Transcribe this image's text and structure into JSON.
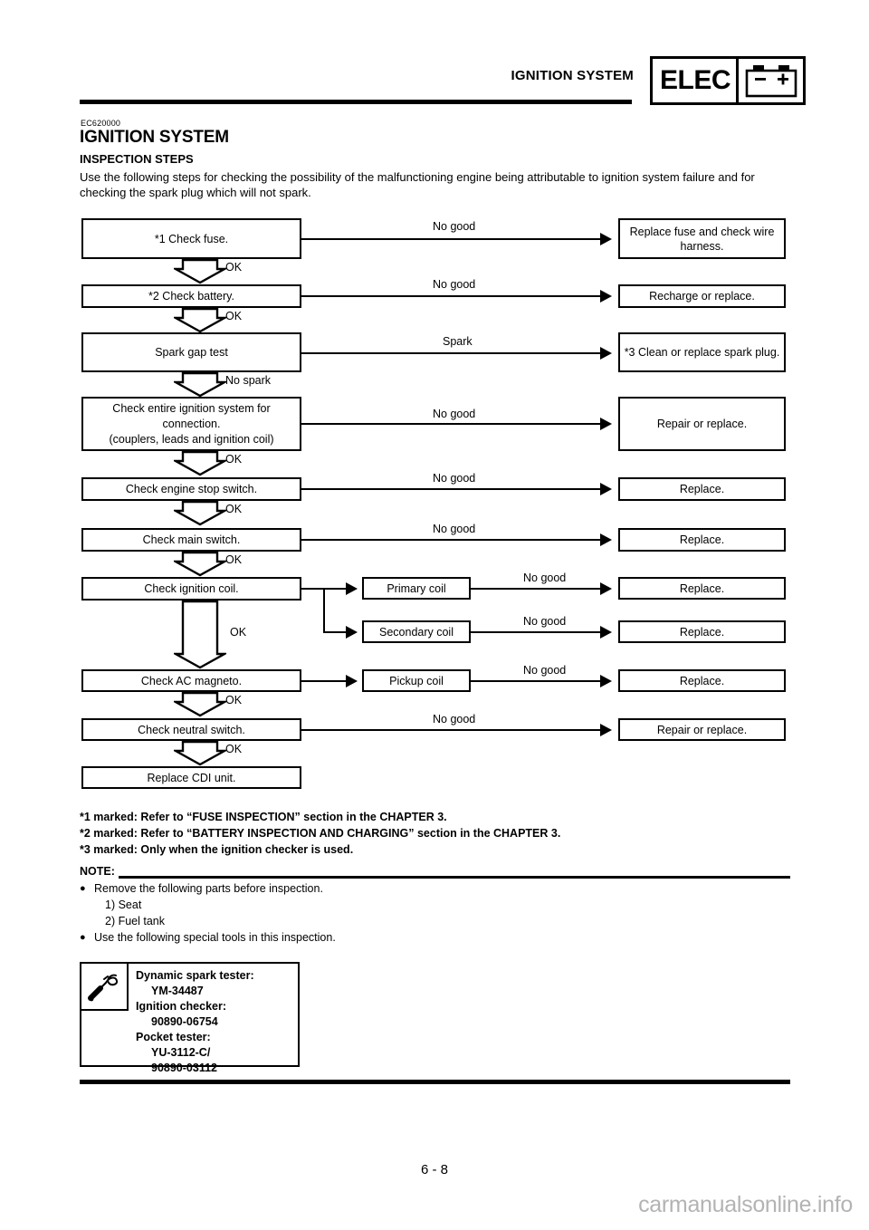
{
  "header": {
    "running_title": "IGNITION SYSTEM",
    "badge_text": "ELEC",
    "badge_icon": "battery-icon",
    "battery_minus": "–",
    "battery_plus": "+"
  },
  "document": {
    "ec_code": "EC620000",
    "title": "IGNITION SYSTEM",
    "subtitle": "INSPECTION STEPS",
    "intro": "Use the following steps for checking the possibility of the malfunctioning engine being attributable to ignition system failure and for checking the spark plug which will not spark."
  },
  "flowchart": {
    "type": "flowchart",
    "steps": [
      {
        "id": "check-fuse",
        "label": "*1 Check fuse.",
        "branch_label": "No good",
        "result": "Replace fuse and check wire harness.",
        "pass_label": "OK"
      },
      {
        "id": "check-battery",
        "label": "*2 Check battery.",
        "branch_label": "No good",
        "result": "Recharge or replace.",
        "pass_label": "OK"
      },
      {
        "id": "spark-gap-test",
        "label": "Spark gap test",
        "branch_label": "Spark",
        "result": "*3 Clean or replace spark plug.",
        "pass_label": "No spark"
      },
      {
        "id": "check-ignition-connections",
        "label": "Check entire ignition system for connection.\n(couplers, leads and ignition coil)",
        "branch_label": "No good",
        "result": "Repair or replace.",
        "pass_label": "OK"
      },
      {
        "id": "check-engine-stop-switch",
        "label": "Check engine stop switch.",
        "branch_label": "No good",
        "result": "Replace.",
        "pass_label": "OK"
      },
      {
        "id": "check-main-switch",
        "label": "Check main switch.",
        "branch_label": "No good",
        "result": "Replace.",
        "pass_label": "OK"
      },
      {
        "id": "check-ignition-coil",
        "label": "Check ignition coil.",
        "pass_label": "OK",
        "sub_steps": [
          {
            "id": "primary-coil",
            "label": "Primary coil",
            "branch_label": "No good",
            "result": "Replace."
          },
          {
            "id": "secondary-coil",
            "label": "Secondary coil",
            "branch_label": "No good",
            "result": "Replace."
          }
        ]
      },
      {
        "id": "check-ac-magneto",
        "label": "Check AC magneto.",
        "pass_label": "OK",
        "sub_steps": [
          {
            "id": "pickup-coil",
            "label": "Pickup coil",
            "branch_label": "No good",
            "result": "Replace."
          }
        ]
      },
      {
        "id": "check-neutral-switch",
        "label": "Check neutral switch.",
        "branch_label": "No good",
        "result": "Repair or replace.",
        "pass_label": "OK"
      },
      {
        "id": "replace-cdi-unit",
        "label": "Replace CDI unit."
      }
    ]
  },
  "footnotes": [
    "*1 marked: Refer to “FUSE INSPECTION” section in the CHAPTER 3.",
    "*2 marked: Refer to “BATTERY INSPECTION AND CHARGING” section in the CHAPTER 3.",
    "*3 marked: Only when the ignition checker is used."
  ],
  "note": {
    "heading": "NOTE:",
    "bullet1": "Remove the following parts before inspection.",
    "sub1": "1) Seat",
    "sub2": "2) Fuel tank",
    "bullet2": "Use the following special tools in this inspection."
  },
  "toolbox": {
    "icon": "spark-tester-icon",
    "lines": [
      {
        "text": "Dynamic spark tester:",
        "indent": false
      },
      {
        "text": "YM-34487",
        "indent": true
      },
      {
        "text": "Ignition checker:",
        "indent": false
      },
      {
        "text": "90890-06754",
        "indent": true
      },
      {
        "text": "Pocket tester:",
        "indent": false
      },
      {
        "text": "YU-3112-C/",
        "indent": true
      },
      {
        "text": "90890-03112",
        "indent": true
      }
    ]
  },
  "footer": {
    "page_number": "6 - 8",
    "watermark": "carmanualsonline.info"
  }
}
